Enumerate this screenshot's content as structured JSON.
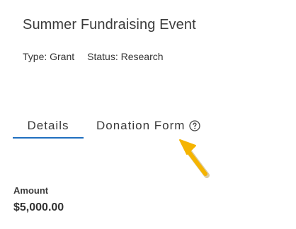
{
  "record": {
    "title": "Summer Fundraising Event",
    "type_text": "Type: Grant",
    "status_text": "Status: Research"
  },
  "tabs": [
    {
      "label": "Details",
      "active": true
    },
    {
      "label": "Donation Form",
      "active": false,
      "icon": "help-circle-icon"
    }
  ],
  "fields": {
    "amount_label": "Amount",
    "amount_value": "$5,000.00"
  },
  "colors": {
    "active_tab_underline": "#1f6fbf",
    "annotation_arrow": "#f5b400"
  }
}
